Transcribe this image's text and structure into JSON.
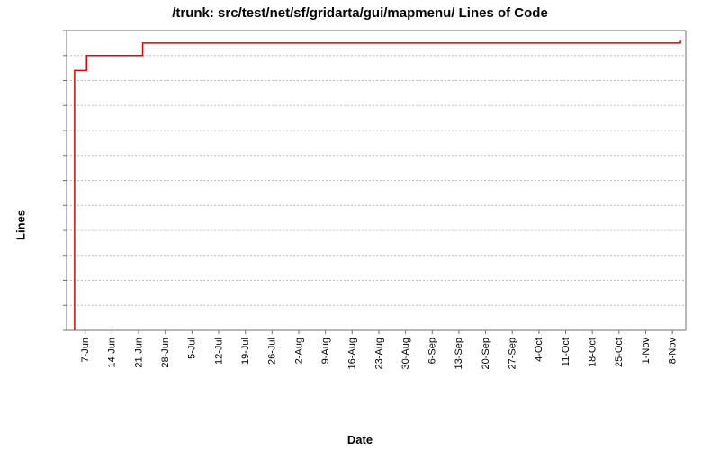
{
  "chart_data": {
    "type": "line",
    "title": "/trunk: src/test/net/sf/gridarta/gui/mapmenu/ Lines of Code",
    "xlabel": "Date",
    "ylabel": "Lines",
    "ylim": [
      0,
      120
    ],
    "y_ticks": [
      0,
      10,
      20,
      30,
      40,
      50,
      60,
      70,
      80,
      90,
      100,
      110,
      120
    ],
    "x_ticks": [
      "7-Jun",
      "14-Jun",
      "21-Jun",
      "28-Jun",
      "5-Jul",
      "12-Jul",
      "19-Jul",
      "26-Jul",
      "2-Aug",
      "9-Aug",
      "16-Aug",
      "23-Aug",
      "30-Aug",
      "6-Sep",
      "13-Sep",
      "20-Sep",
      "27-Sep",
      "4-Oct",
      "11-Oct",
      "18-Oct",
      "25-Oct",
      "1-Nov",
      "8-Nov"
    ],
    "series": [
      {
        "name": "Lines of Code",
        "points": [
          {
            "x_index": -0.4,
            "y": 0
          },
          {
            "x_index": -0.4,
            "y": 104
          },
          {
            "x_index": 0.05,
            "y": 104
          },
          {
            "x_index": 0.05,
            "y": 110
          },
          {
            "x_index": 2.15,
            "y": 110
          },
          {
            "x_index": 2.15,
            "y": 115
          },
          {
            "x_index": 22.3,
            "y": 115
          },
          {
            "x_index": 22.3,
            "y": 116
          }
        ]
      }
    ]
  }
}
